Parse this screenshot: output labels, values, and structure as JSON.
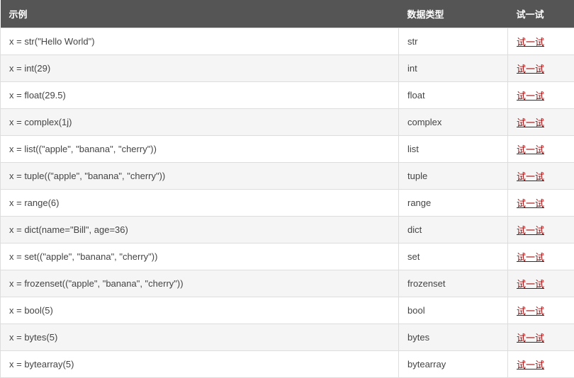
{
  "table": {
    "headers": {
      "example": "示例",
      "datatype": "数据类型",
      "tryit": "试一试"
    },
    "try_label": "试一试",
    "rows": [
      {
        "example": "x = str(\"Hello World\")",
        "type": "str"
      },
      {
        "example": "x = int(29)",
        "type": "int"
      },
      {
        "example": "x = float(29.5)",
        "type": "float"
      },
      {
        "example": "x = complex(1j)",
        "type": "complex"
      },
      {
        "example": "x = list((\"apple\", \"banana\", \"cherry\"))",
        "type": "list"
      },
      {
        "example": "x = tuple((\"apple\", \"banana\", \"cherry\"))",
        "type": "tuple"
      },
      {
        "example": "x = range(6)",
        "type": "range"
      },
      {
        "example": "x = dict(name=\"Bill\", age=36)",
        "type": "dict"
      },
      {
        "example": "x = set((\"apple\", \"banana\", \"cherry\"))",
        "type": "set"
      },
      {
        "example": "x = frozenset((\"apple\", \"banana\", \"cherry\"))",
        "type": "frozenset"
      },
      {
        "example": "x = bool(5)",
        "type": "bool"
      },
      {
        "example": "x = bytes(5)",
        "type": "bytes"
      },
      {
        "example": "x = bytearray(5)",
        "type": "bytearray"
      }
    ]
  }
}
